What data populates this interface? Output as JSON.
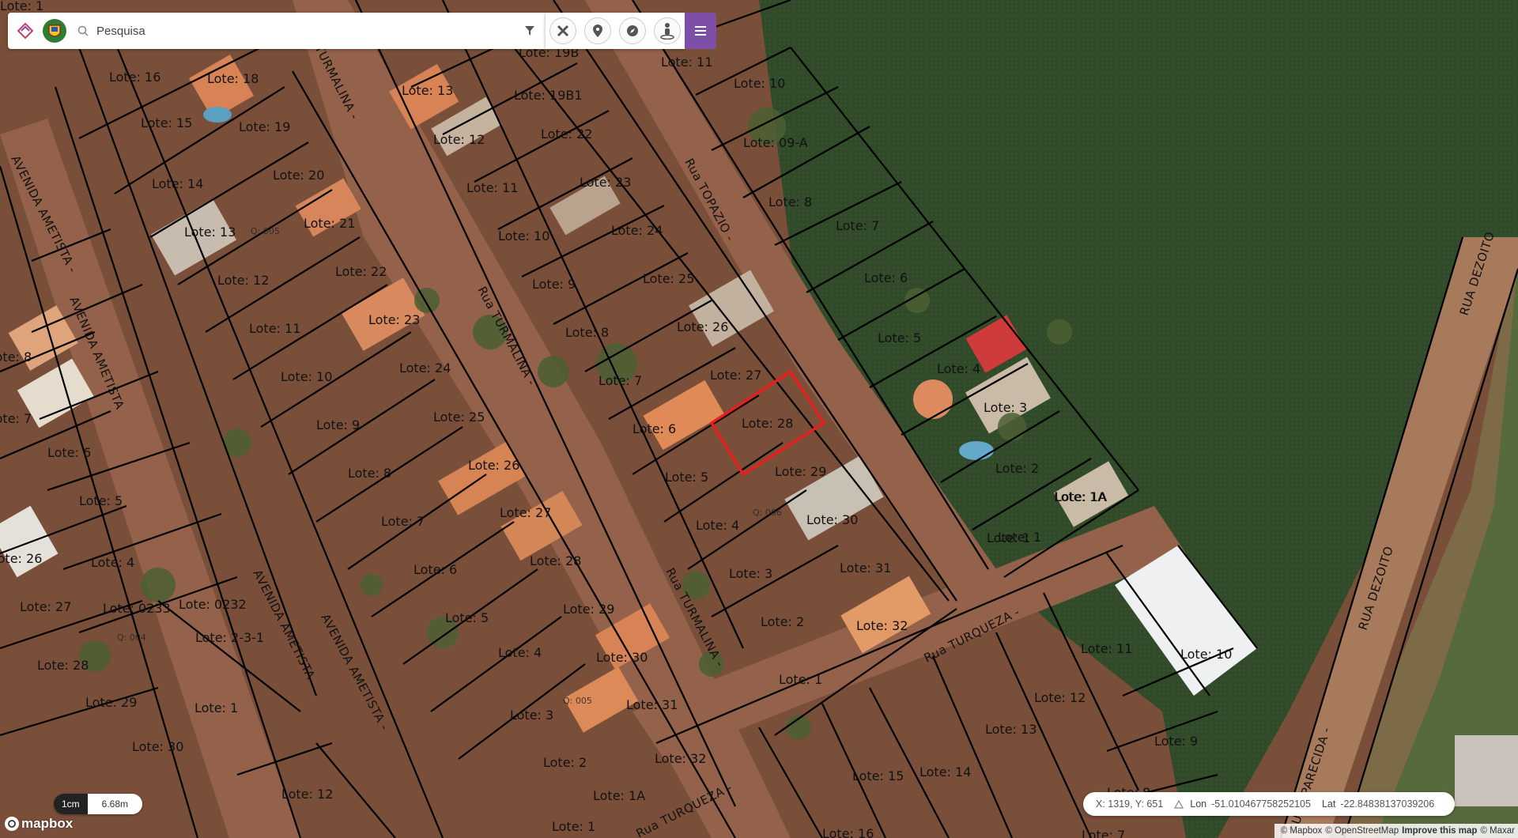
{
  "toolbar": {
    "search_placeholder": "Pesquisa",
    "app_logo_icon": "app-logo-icon",
    "crest_icon": "municipal-crest-icon",
    "search_icon": "search-icon",
    "filter_icon": "filter-icon",
    "tools": [
      {
        "name": "measure-tools-button",
        "icon": "ruler-pencil-icon"
      },
      {
        "name": "place-marker-button",
        "icon": "map-pin-icon"
      },
      {
        "name": "navigation-button",
        "icon": "compass-icon"
      },
      {
        "name": "street-view-button",
        "icon": "pegman-icon"
      }
    ],
    "menu_icon": "hamburger-menu-icon",
    "accent_color": "#7d4fa6"
  },
  "map": {
    "lots": [
      {
        "text": "Lote: 1"
      },
      {
        "text": "Lote: 16"
      },
      {
        "text": "Lote: 18"
      },
      {
        "text": "Lote: 15"
      },
      {
        "text": "Lote: 19"
      },
      {
        "text": "Lote: 14"
      },
      {
        "text": "Lote: 20"
      },
      {
        "text": "Lote: 13"
      },
      {
        "text": "Q: 005"
      },
      {
        "text": "Lote: 21"
      },
      {
        "text": "Lote: 12"
      },
      {
        "text": "Lote: 22"
      },
      {
        "text": "Lote: 11"
      },
      {
        "text": "Lote: 23"
      },
      {
        "text": "Lote: 10"
      },
      {
        "text": "Lote: 24"
      },
      {
        "text": "Lote: 9"
      },
      {
        "text": "Lote: 25"
      },
      {
        "text": "Lote: 8"
      },
      {
        "text": "Lote: 26"
      },
      {
        "text": "Lote: 7"
      },
      {
        "text": "Lote: 27"
      },
      {
        "text": "Lote: 6"
      },
      {
        "text": "Lote: 28"
      },
      {
        "text": "Lote: 5"
      },
      {
        "text": "Lote: 29"
      },
      {
        "text": "Lote: 4"
      },
      {
        "text": "Lote: 30"
      },
      {
        "text": "Lote: 3"
      },
      {
        "text": "Lote: 31"
      },
      {
        "text": "Lote: 2"
      },
      {
        "text": "Lote: 32"
      },
      {
        "text": "Lote: 1A"
      },
      {
        "text": "Lote: 1"
      },
      {
        "text": "Lote: 13"
      },
      {
        "text": "Lote: 19B"
      },
      {
        "text": "Lote: 12"
      },
      {
        "text": "Lote: 19B1"
      },
      {
        "text": "Lote: 22"
      },
      {
        "text": "Lote: 11"
      },
      {
        "text": "Lote: 23"
      },
      {
        "text": "Lote: 10"
      },
      {
        "text": "Lote: 24"
      },
      {
        "text": "Lote: 9"
      },
      {
        "text": "Lote: 25"
      },
      {
        "text": "Lote: 8"
      },
      {
        "text": "Lote: 26"
      },
      {
        "text": "Lote: 7"
      },
      {
        "text": "Lote: 27"
      },
      {
        "text": "Lote: 6"
      },
      {
        "text": "Lote: 28"
      },
      {
        "text": "Lote: 5"
      },
      {
        "text": "Lote: 29"
      },
      {
        "text": "Lote: 4"
      },
      {
        "text": "Q: 006"
      },
      {
        "text": "Lote: 30"
      },
      {
        "text": "Lote: 3"
      },
      {
        "text": "Lote: 31"
      },
      {
        "text": "Lote: 2"
      },
      {
        "text": "Lote: 32"
      },
      {
        "text": "Lote: 1"
      },
      {
        "text": "Lote: 11"
      },
      {
        "text": "Lote: 10"
      },
      {
        "text": "Lote: 09-A"
      },
      {
        "text": "Lote: 8"
      },
      {
        "text": "Lote: 7"
      },
      {
        "text": "Lote: 6"
      },
      {
        "text": "Lote: 5"
      },
      {
        "text": "Lote: 4"
      },
      {
        "text": "Lote: 3"
      },
      {
        "text": "Lote: 2"
      },
      {
        "text": "Lote: 1A"
      },
      {
        "text": "Lote: 1"
      },
      {
        "text": "Lote: 8"
      },
      {
        "text": "Lote: 7"
      },
      {
        "text": "Lote: 6"
      },
      {
        "text": "Lote: 5"
      },
      {
        "text": "Lote: 4"
      },
      {
        "text": "Lote: 26"
      },
      {
        "text": "Lote: 27"
      },
      {
        "text": "Lote: 0233"
      },
      {
        "text": "Lote: 0232"
      },
      {
        "text": "Q: 004"
      },
      {
        "text": "Lote: 2-3-1"
      },
      {
        "text": "Lote: 28"
      },
      {
        "text": "Lote: 29"
      },
      {
        "text": "Lote: 1"
      },
      {
        "text": "Lote: 30"
      },
      {
        "text": "Lote: 12"
      },
      {
        "text": "Q: 005"
      },
      {
        "text": "Lote: 1A"
      },
      {
        "text": "Lote: 1"
      },
      {
        "text": "Lote: 11"
      },
      {
        "text": "Lote: 10"
      },
      {
        "text": "Lote: 12"
      },
      {
        "text": "Lote: 13"
      },
      {
        "text": "Lote: 9"
      },
      {
        "text": "Lote: 15"
      },
      {
        "text": "Lote: 14"
      },
      {
        "text": "Lote: 16"
      },
      {
        "text": "Lote: 8"
      },
      {
        "text": "Lote: 7"
      }
    ],
    "streets": [
      {
        "text": "AVENIDA AMETISTA -"
      },
      {
        "text": "AVENIDA AMETISTA"
      },
      {
        "text": "AVENIDA AMETISTA"
      },
      {
        "text": "AVENIDA AMETISTA -"
      },
      {
        "text": "TURMALINA -"
      },
      {
        "text": "Rua TURMALINA -"
      },
      {
        "text": "Rua TURMALINA -"
      },
      {
        "text": "Rua TOPAZIO -"
      },
      {
        "text": "Rua TURQUEZA -"
      },
      {
        "text": "Rua TURQUEZA -"
      },
      {
        "text": "RUA DEZOITO"
      },
      {
        "text": "RUA DEZOITO"
      },
      {
        "text": "RUA APARECIDA -"
      }
    ],
    "selected_lot": "Lote: 28",
    "selection_color": "#e8201d"
  },
  "scale": {
    "unit": "1cm",
    "value": "6.68m"
  },
  "logo": {
    "text": "mapbox"
  },
  "coords": {
    "xy": "X: 1319, Y: 651",
    "lon_label": "Lon",
    "lon_value": "-51.010467758252105",
    "lat_label": "Lat",
    "lat_value": "-22.84838137039206"
  },
  "attribution": {
    "mapbox": "© Mapbox",
    "osm": "© OpenStreetMap",
    "improve": "Improve this map",
    "maxar": "© Maxar"
  }
}
